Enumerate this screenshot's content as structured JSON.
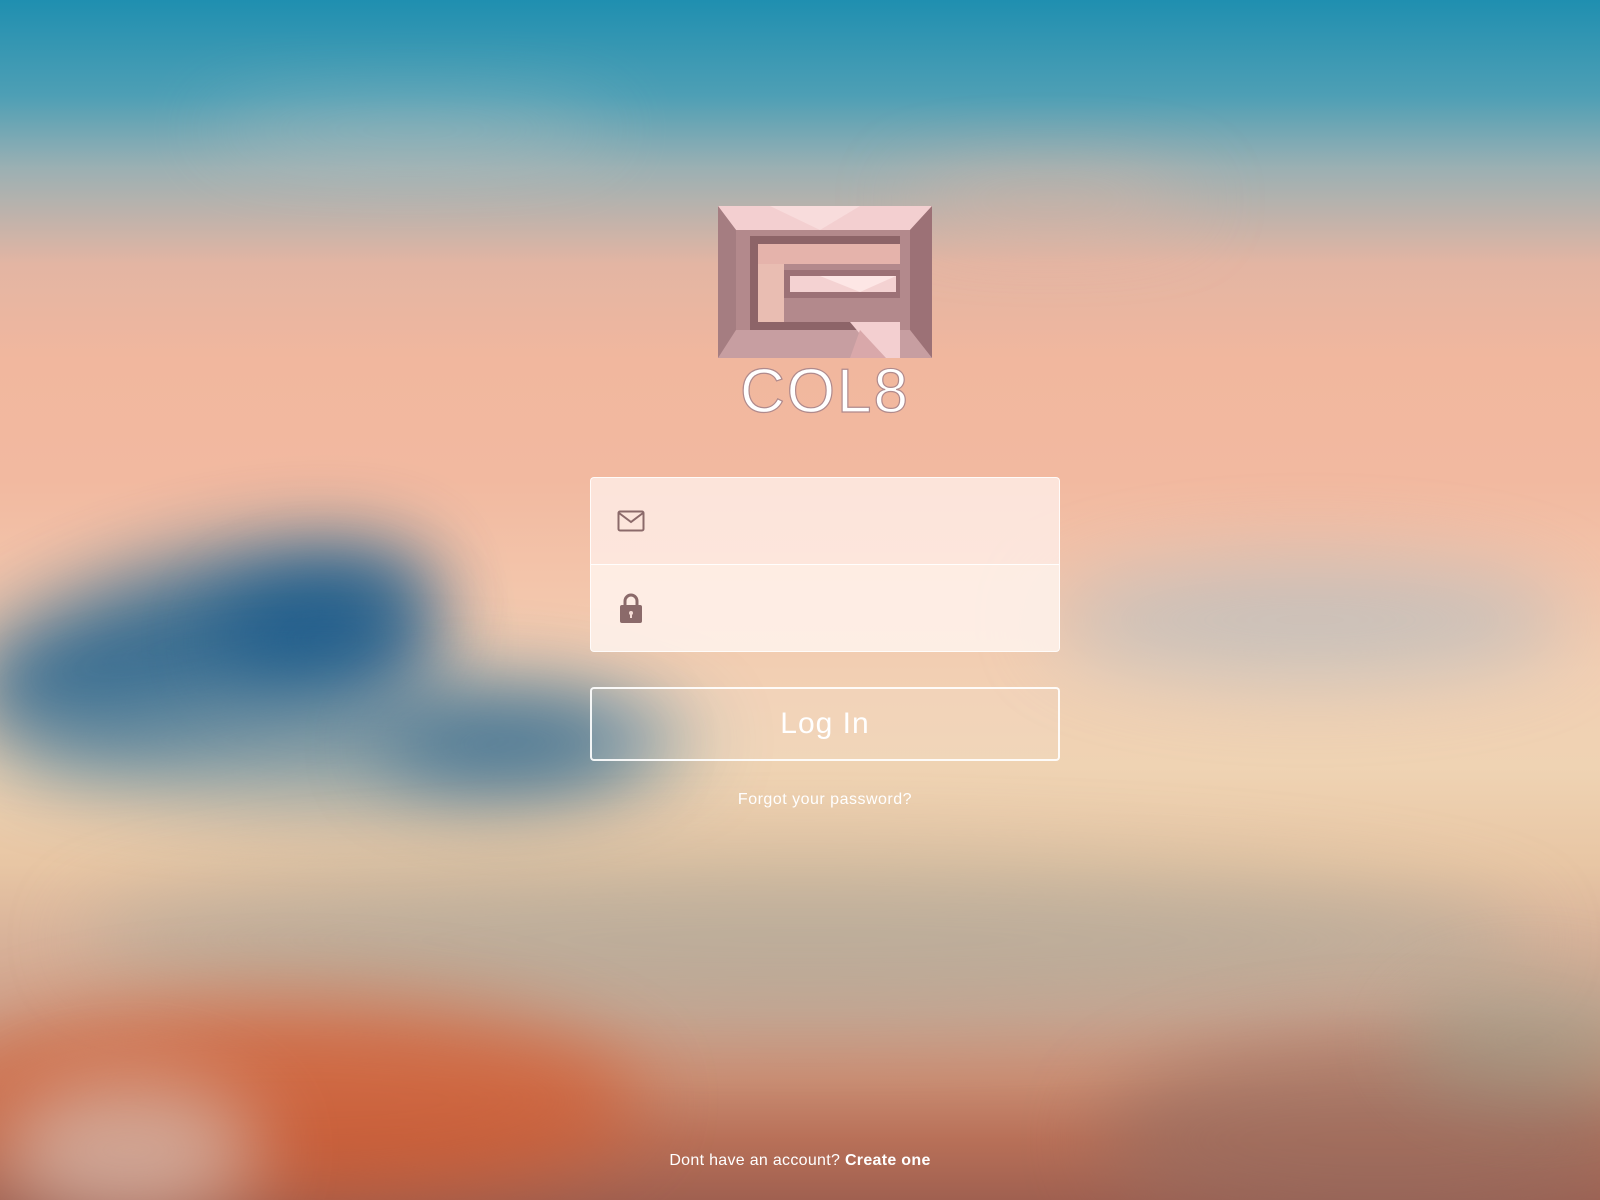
{
  "brand": {
    "logo_text": "COL8",
    "logo_primary_color": "#b08a8c",
    "logo_light_color": "#f2c6c7"
  },
  "login_form": {
    "email_field": {
      "icon": "envelope-icon",
      "value": "",
      "placeholder": ""
    },
    "password_field": {
      "icon": "lock-icon",
      "value": "",
      "placeholder": ""
    },
    "login_button_label": "Log In",
    "forgot_password_label": "Forgot your password?"
  },
  "footer": {
    "signup_prompt": "Dont have an account?",
    "signup_link_label": "Create one"
  },
  "colors": {
    "icon_color": "#8b6a6a",
    "text_color": "#ffffff"
  }
}
